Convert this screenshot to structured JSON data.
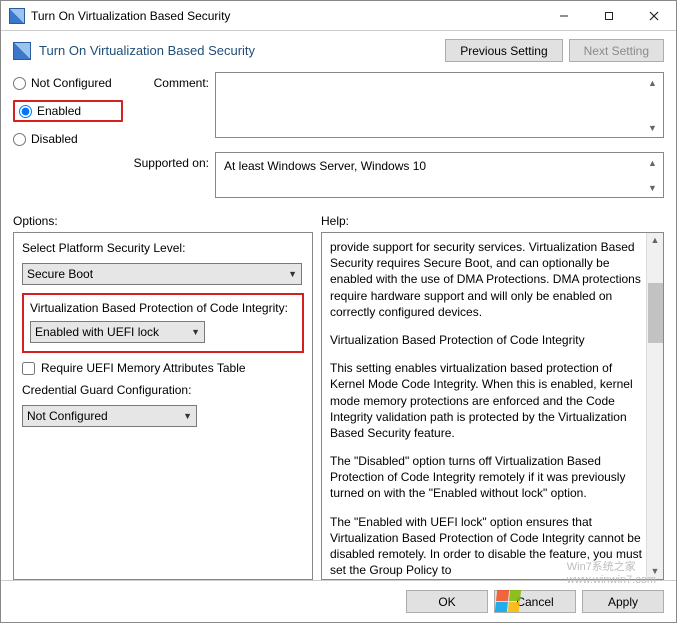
{
  "titlebar": {
    "title": "Turn On Virtualization Based Security"
  },
  "header": {
    "title": "Turn On Virtualization Based Security",
    "prev_btn": "Previous Setting",
    "next_btn": "Next Setting"
  },
  "state": {
    "not_configured": "Not Configured",
    "enabled": "Enabled",
    "disabled": "Disabled"
  },
  "comment_label": "Comment:",
  "supported_label": "Supported on:",
  "supported_value": "At least Windows Server, Windows 10",
  "options_label": "Options:",
  "help_label": "Help:",
  "options": {
    "platform_level_label": "Select Platform Security Level:",
    "platform_level_value": "Secure Boot",
    "vbpci_label": "Virtualization Based Protection of Code Integrity:",
    "vbpci_value": "Enabled with UEFI lock",
    "require_uefi_mat": "Require UEFI Memory Attributes Table",
    "cred_guard_label": "Credential Guard Configuration:",
    "cred_guard_value": "Not Configured"
  },
  "help": {
    "p1": "provide support for security services. Virtualization Based Security requires Secure Boot, and can optionally be enabled with the use of DMA Protections. DMA protections require hardware support and will only be enabled on correctly configured devices.",
    "p2": "Virtualization Based Protection of Code Integrity",
    "p3": "This setting enables virtualization based protection of Kernel Mode Code Integrity. When this is enabled, kernel mode memory protections are enforced and the Code Integrity validation path is protected by the Virtualization Based Security feature.",
    "p4": "The \"Disabled\" option turns off Virtualization Based Protection of Code Integrity remotely if it was previously turned on with the \"Enabled without lock\" option.",
    "p5": "The \"Enabled with UEFI lock\" option ensures that Virtualization Based Protection of Code Integrity cannot be disabled remotely. In order to disable the feature, you must set the Group Policy to"
  },
  "footer": {
    "ok": "OK",
    "cancel": "Cancel",
    "apply": "Apply"
  },
  "watermark": {
    "line1": "Win7系统之家",
    "line2": "www.winwin7.com"
  }
}
